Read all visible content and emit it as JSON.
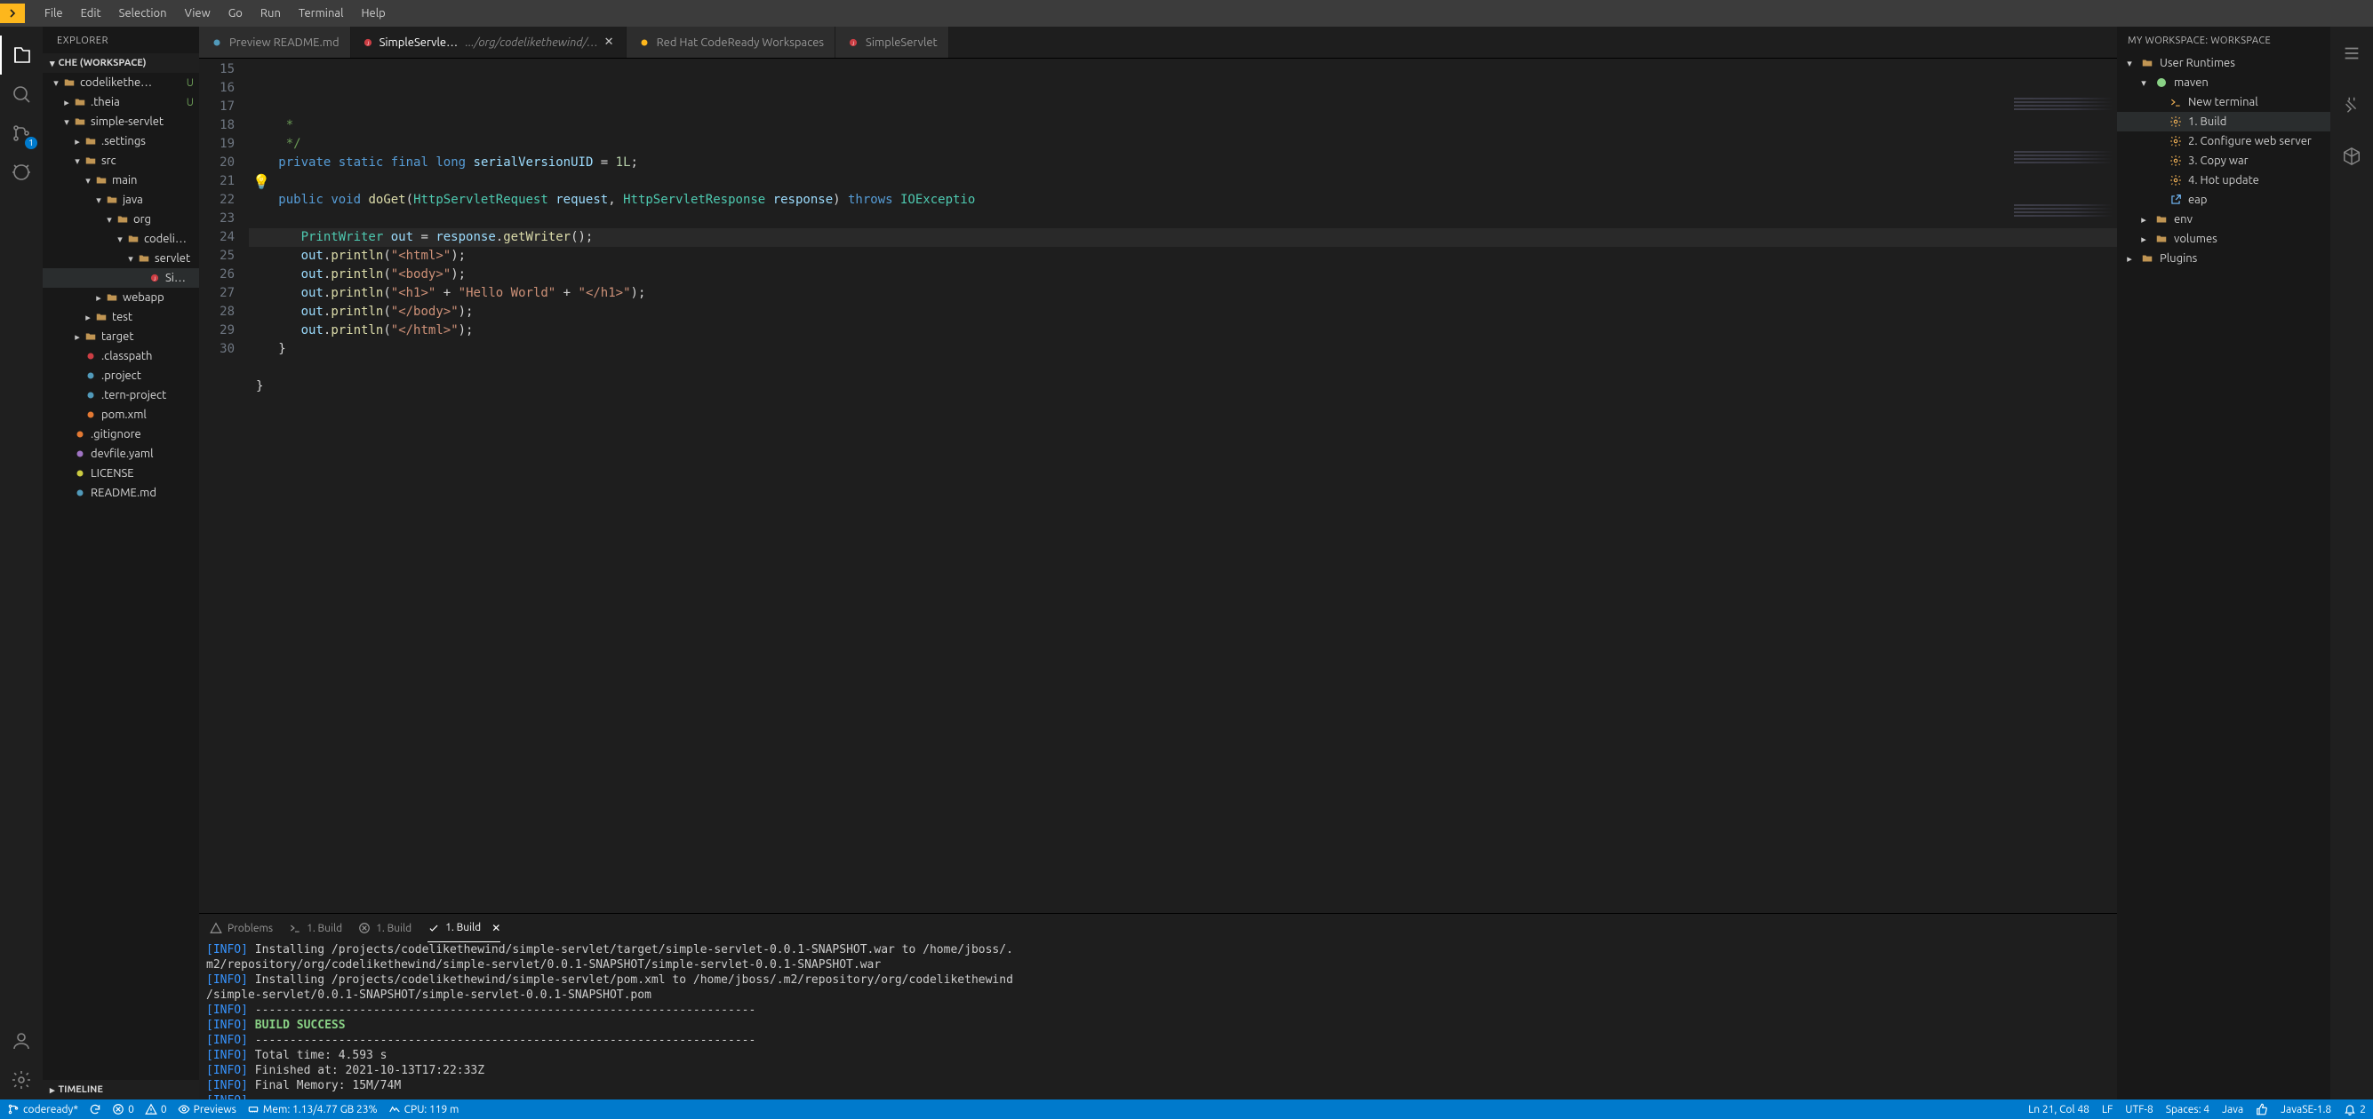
{
  "menubar": {
    "items": [
      "File",
      "Edit",
      "Selection",
      "View",
      "Go",
      "Run",
      "Terminal",
      "Help"
    ]
  },
  "activitybar": {
    "scm_badge": "1"
  },
  "explorer": {
    "title": "EXPLORER",
    "workspace_label": "CHE (WORKSPACE)",
    "timeline_label": "TIMELINE",
    "tree": [
      {
        "d": 0,
        "t": "folder",
        "o": true,
        "l": "codelikethe…",
        "badge": "U"
      },
      {
        "d": 1,
        "t": "folder",
        "o": false,
        "l": ".theia",
        "badge": "U"
      },
      {
        "d": 1,
        "t": "folder",
        "o": true,
        "l": "simple-servlet"
      },
      {
        "d": 2,
        "t": "folder",
        "o": false,
        "l": ".settings"
      },
      {
        "d": 2,
        "t": "folder",
        "o": true,
        "l": "src"
      },
      {
        "d": 3,
        "t": "folder",
        "o": true,
        "l": "main"
      },
      {
        "d": 4,
        "t": "folder",
        "o": true,
        "l": "java"
      },
      {
        "d": 5,
        "t": "folder",
        "o": true,
        "l": "org"
      },
      {
        "d": 6,
        "t": "folder",
        "o": true,
        "l": "codeli…"
      },
      {
        "d": 7,
        "t": "folder",
        "o": true,
        "l": "servlet"
      },
      {
        "d": 8,
        "t": "file",
        "ic": "java",
        "l": "Sim…",
        "sel": true
      },
      {
        "d": 4,
        "t": "folder",
        "o": false,
        "l": "webapp"
      },
      {
        "d": 3,
        "t": "folder",
        "o": false,
        "l": "test"
      },
      {
        "d": 2,
        "t": "folder",
        "o": false,
        "l": "target"
      },
      {
        "d": 2,
        "t": "file",
        "ic": "dotred",
        "l": ".classpath"
      },
      {
        "d": 2,
        "t": "file",
        "ic": "dotblue",
        "l": ".project"
      },
      {
        "d": 2,
        "t": "file",
        "ic": "tern",
        "l": ".tern-project"
      },
      {
        "d": 2,
        "t": "file",
        "ic": "xml",
        "l": "pom.xml"
      },
      {
        "d": 1,
        "t": "file",
        "ic": "git",
        "l": ".gitignore"
      },
      {
        "d": 1,
        "t": "file",
        "ic": "yaml",
        "l": "devfile.yaml"
      },
      {
        "d": 1,
        "t": "file",
        "ic": "license",
        "l": "LICENSE"
      },
      {
        "d": 1,
        "t": "file",
        "ic": "readme",
        "l": "README.md"
      }
    ]
  },
  "tabs": [
    {
      "icon": "md",
      "label": "Preview README.md"
    },
    {
      "icon": "java",
      "label": "SimpleServlet.java",
      "desc": ".../org/codelikethewind/servlet",
      "active": true,
      "close": true
    },
    {
      "icon": "che",
      "label": "Red Hat CodeReady Workspaces"
    },
    {
      "icon": "java",
      "label": "SimpleServlet"
    }
  ],
  "editor": {
    "first_line": 15,
    "highlight_line": 21,
    "lines": [
      {
        "html": "    <span class='tok-comment'>*</span>"
      },
      {
        "html": "    <span class='tok-comment'>*/</span>"
      },
      {
        "html": "   <span class='tok-kw'>private</span> <span class='tok-kw'>static</span> <span class='tok-kw'>final</span> <span class='tok-kw'>long</span> <span class='tok-var'>serialVersionUID</span> = <span class='tok-num'>1L</span>;"
      },
      {
        "html": ""
      },
      {
        "html": "   <span class='tok-kw'>public</span> <span class='tok-kw'>void</span> <span class='tok-fn'>doGet</span>(<span class='tok-type'>HttpServletRequest</span> <span class='tok-var'>request</span>, <span class='tok-type'>HttpServletResponse</span> <span class='tok-var'>response</span>) <span class='tok-kw'>throws</span> <span class='tok-type'>IOExceptio</span>"
      },
      {
        "html": ""
      },
      {
        "html": "      <span class='tok-type'>PrintWriter</span> <span class='tok-var'>out</span> = <span class='tok-var'>response</span>.<span class='tok-fn'>getWriter</span>();"
      },
      {
        "html": "      <span class='tok-var'>out</span>.<span class='tok-fn'>println</span>(<span class='tok-str'>\"&lt;html&gt;\"</span>);"
      },
      {
        "html": "      <span class='tok-var'>out</span>.<span class='tok-fn'>println</span>(<span class='tok-str'>\"&lt;body&gt;\"</span>);"
      },
      {
        "html": "      <span class='tok-var'>out</span>.<span class='tok-fn'>println</span>(<span class='tok-str'>\"&lt;h1&gt;\"</span> + <span class='tok-str'>\"Hello World\"</span> + <span class='tok-str'>\"&lt;/h1&gt;\"</span>);"
      },
      {
        "html": "      <span class='tok-var'>out</span>.<span class='tok-fn'>println</span>(<span class='tok-str'>\"&lt;/body&gt;\"</span>);"
      },
      {
        "html": "      <span class='tok-var'>out</span>.<span class='tok-fn'>println</span>(<span class='tok-str'>\"&lt;/html&gt;\"</span>);"
      },
      {
        "html": "   }"
      },
      {
        "html": ""
      },
      {
        "html": "}"
      },
      {
        "html": ""
      }
    ]
  },
  "panel": {
    "tabs": [
      {
        "icon": "warning",
        "label": "Problems"
      },
      {
        "icon": "terminal",
        "label": "1. Build"
      },
      {
        "icon": "error",
        "label": "1. Build"
      },
      {
        "icon": "check",
        "label": "1. Build",
        "active": true,
        "close": true
      }
    ],
    "lines": [
      {
        "p": "[INFO] ",
        "t": "Installing /projects/codelikethewind/simple-servlet/target/simple-servlet-0.0.1-SNAPSHOT.war to /home/jboss/."
      },
      {
        "p": "",
        "t": "m2/repository/org/codelikethewind/simple-servlet/0.0.1-SNAPSHOT/simple-servlet-0.0.1-SNAPSHOT.war"
      },
      {
        "p": "[INFO] ",
        "t": "Installing /projects/codelikethewind/simple-servlet/pom.xml to /home/jboss/.m2/repository/org/codelikethewind"
      },
      {
        "p": "",
        "t": "/simple-servlet/0.0.1-SNAPSHOT/simple-servlet-0.0.1-SNAPSHOT.pom"
      },
      {
        "p": "[INFO] ",
        "t": "------------------------------------------------------------------------"
      },
      {
        "p": "[INFO] ",
        "t": "BUILD SUCCESS",
        "cls": "success"
      },
      {
        "p": "[INFO] ",
        "t": "------------------------------------------------------------------------"
      },
      {
        "p": "[INFO] ",
        "t": "Total time: 4.593 s"
      },
      {
        "p": "[INFO] ",
        "t": "Finished at: 2021-10-13T17:22:33Z"
      },
      {
        "p": "[INFO] ",
        "t": "Final Memory: 15M/74M"
      },
      {
        "p": "[INFO] ",
        "t": "------------------------------------------------------------------------"
      }
    ]
  },
  "workspace": {
    "title": "MY WORKSPACE: WORKSPACE",
    "tree": [
      {
        "d": 0,
        "chev": "down",
        "icon": "folder",
        "l": "User Runtimes"
      },
      {
        "d": 1,
        "chev": "down",
        "icon": "dotgreen",
        "l": "maven"
      },
      {
        "d": 2,
        "chev": "",
        "icon": "terminal",
        "l": "New terminal"
      },
      {
        "d": 2,
        "chev": "",
        "icon": "gear",
        "l": "1. Build",
        "sel": true
      },
      {
        "d": 2,
        "chev": "",
        "icon": "gear",
        "l": "2. Configure web server"
      },
      {
        "d": 2,
        "chev": "",
        "icon": "gear",
        "l": "3. Copy war"
      },
      {
        "d": 2,
        "chev": "",
        "icon": "gear",
        "l": "4. Hot update"
      },
      {
        "d": 2,
        "chev": "",
        "icon": "link",
        "l": "eap"
      },
      {
        "d": 1,
        "chev": "right",
        "icon": "folder",
        "l": "env"
      },
      {
        "d": 1,
        "chev": "right",
        "icon": "folder",
        "l": "volumes"
      },
      {
        "d": 0,
        "chev": "right",
        "icon": "folder",
        "l": "Plugins"
      }
    ]
  },
  "status": {
    "branch": "codeready*",
    "errors": "0",
    "warnings": "0",
    "previews": "Previews",
    "mem": "Mem: 1.13/4.77 GB 23%",
    "cpu": "CPU: 119 m",
    "position": "Ln 21, Col 48",
    "eol": "LF",
    "encoding": "UTF-8",
    "indent": "Spaces: 4",
    "lang": "Java",
    "java_ver": "JavaSE-1.8",
    "bell": "2"
  }
}
